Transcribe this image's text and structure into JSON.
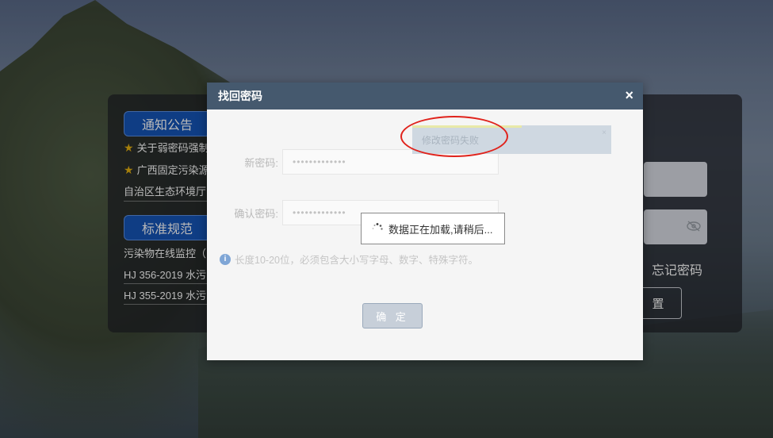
{
  "notices": {
    "title": "通知公告",
    "items": [
      "关于弱密码强制",
      "广西固定污染源",
      "自治区生态环境厅"
    ]
  },
  "standards": {
    "title": "标准规范",
    "items": [
      "污染物在线监控（",
      "HJ 356-2019 水污",
      "HJ 355-2019 水污"
    ]
  },
  "login": {
    "forgot_label": "忘记密码",
    "reset_label": "置"
  },
  "dialog": {
    "title": "找回密码",
    "close_glyph": "×",
    "new_password_label": "新密码:",
    "new_password_value": "•••••••••••••",
    "confirm_password_label": "确认密码:",
    "confirm_password_value": "•••••••••••••",
    "hint": "长度10-20位，必须包含大小写字母、数字、特殊字符。",
    "confirm_button": "确 定"
  },
  "toast": {
    "message": "修改密码失败",
    "close_glyph": "×"
  },
  "loading": {
    "message": "数据正在加载,请稍后..."
  },
  "colors": {
    "header": "#45596e",
    "accent_pill": "#1555b8",
    "annotation_red": "#e0231c"
  }
}
